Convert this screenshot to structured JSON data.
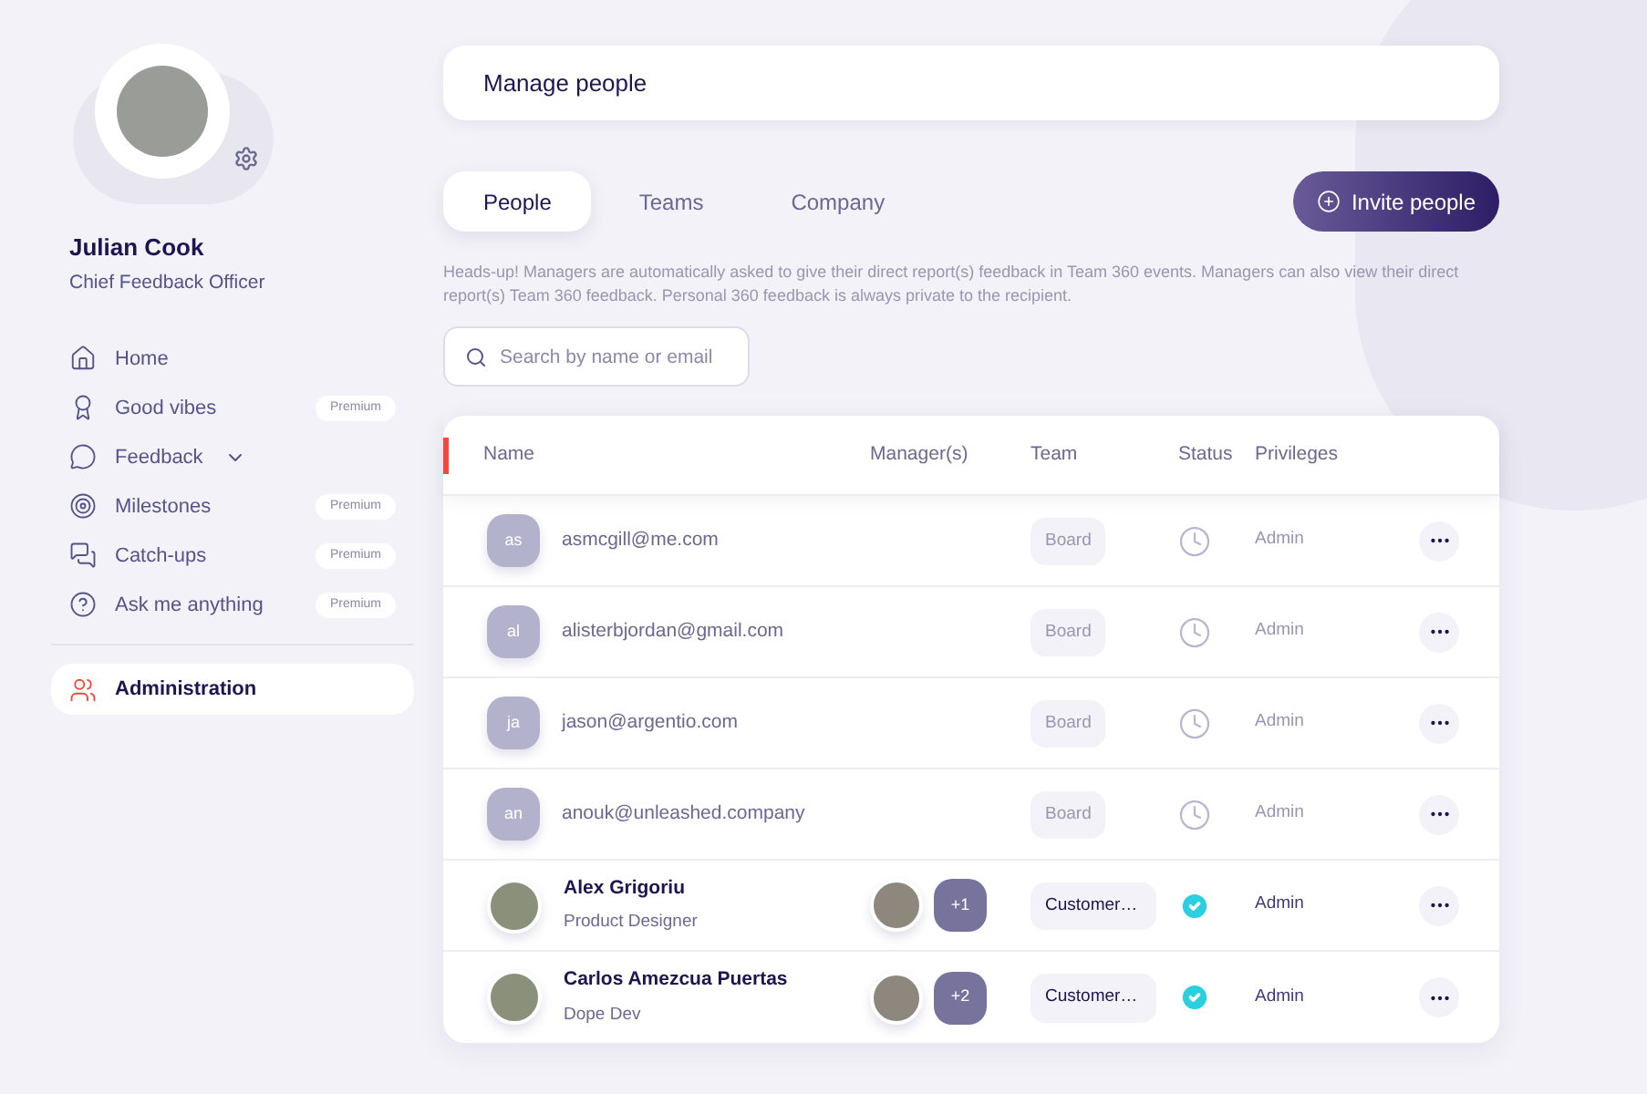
{
  "profile": {
    "name": "Julian Cook",
    "role": "Chief Feedback Officer"
  },
  "nav": [
    {
      "label": "Home",
      "selected": false
    },
    {
      "label": "Good vibes",
      "badge": "Premium",
      "selected": false
    },
    {
      "label": "Feedback",
      "expanded": false,
      "selected": false
    },
    {
      "label": "Milestones",
      "badge": "Premium",
      "selected": false
    },
    {
      "label": "Catch-ups",
      "badge": "Premium",
      "selected": false
    },
    {
      "label": "Ask me anything",
      "badge": "Premium",
      "selected": false
    },
    {
      "label": "Administration",
      "selected": true,
      "divider_before": true
    }
  ],
  "header": {
    "title": "Manage people"
  },
  "tabs": [
    {
      "label": "People",
      "selected": true
    },
    {
      "label": "Teams",
      "selected": false
    },
    {
      "label": "Company",
      "selected": false
    }
  ],
  "invite_button": "Invite people",
  "notice": "Heads-up! Managers are automatically asked to give their direct report(s) feedback in Team 360 events. Managers can also view their direct report(s) Team 360 feedback. Personal 360 feedback is always private to the recipient.",
  "search": {
    "placeholder": "Search by name or email"
  },
  "table": {
    "columns": [
      "Name",
      "Manager(s)",
      "Team",
      "Status",
      "Privileges"
    ],
    "rows": [
      {
        "kind": "invited",
        "initials": "as",
        "name": "asmcgill@me.com",
        "team": "Board",
        "pending": true,
        "privileges": "Admin"
      },
      {
        "kind": "invited",
        "initials": "al",
        "name": "alisterbjordan@gmail.com",
        "team": "Board",
        "pending": true,
        "privileges": "Admin"
      },
      {
        "kind": "invited",
        "initials": "ja",
        "name": "jason@argentio.com",
        "team": "Board",
        "pending": true,
        "privileges": "Admin"
      },
      {
        "kind": "invited",
        "initials": "an",
        "name": "anouk@unleashed.company",
        "team": "Board",
        "pending": true,
        "privileges": "Admin"
      },
      {
        "kind": "member",
        "name": "Alex Grigoriu",
        "title": "Product Designer",
        "managers_more": "+1",
        "team": "Customer…",
        "pending": false,
        "privileges": "Admin"
      },
      {
        "kind": "member",
        "name": "Carlos Amezcua Puertas",
        "title": "Dope Dev",
        "managers_more": "+2",
        "team": "Customer…",
        "pending": false,
        "privileges": "Admin"
      }
    ]
  }
}
